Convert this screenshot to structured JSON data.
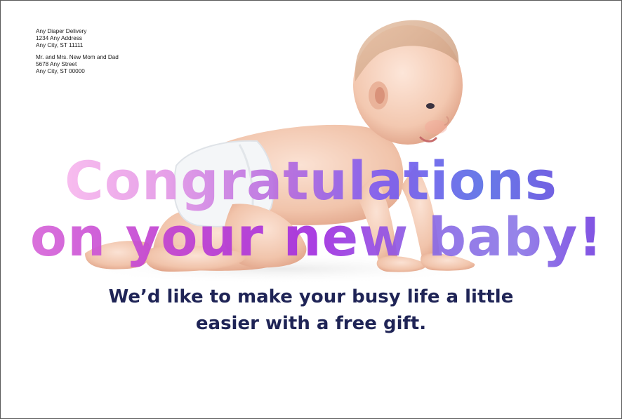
{
  "sender": {
    "name": "Any Diaper Delivery",
    "street": "1234 Any Address",
    "city": "Any City, ST 11111"
  },
  "recipient": {
    "name": "Mr. and Mrs. New Mom and Dad",
    "street": "5678 Any Street",
    "city": "Any City, ST 00000"
  },
  "headline": {
    "line1": "Congratulations",
    "line2": "on your new baby!"
  },
  "subhead": {
    "line1": "We’d like to make your busy life a little",
    "line2": "easier with a free gift."
  },
  "colors": {
    "subhead_text": "#1f2456",
    "headline_gradient_start": "#f8b8ee",
    "headline_gradient_mid": "#a22fe0",
    "headline_gradient_end": "#6753e0"
  }
}
